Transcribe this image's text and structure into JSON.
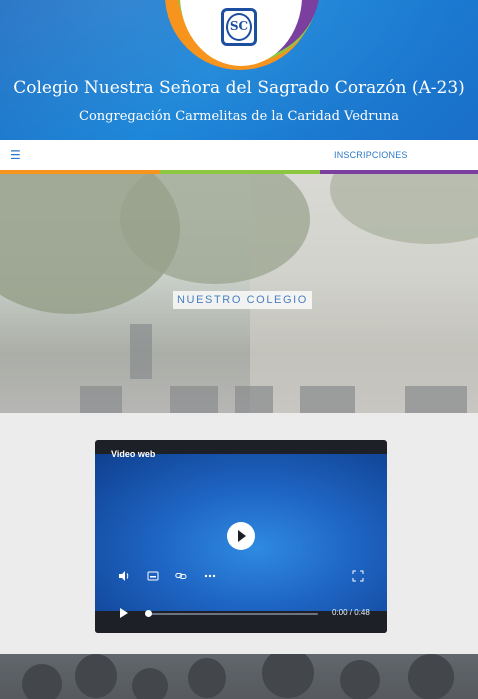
{
  "header": {
    "title": "Colegio Nuestra Señora del Sagrado Corazón (A-23)",
    "subtitle": "Congregación Carmelitas de la Caridad Vedruna",
    "logo_text": "SC",
    "colors": {
      "blue": "#1a85d8",
      "orange": "#f7941d",
      "green": "#8dc63f",
      "purple": "#7b3fa0"
    }
  },
  "nav": {
    "menu_icon": "☰",
    "link": "INSCRIPCIONES"
  },
  "hero": {
    "label": "NUESTRO COLEGIO"
  },
  "video": {
    "title": "Video web",
    "time": "0:00 / 0:48",
    "progress": 0,
    "icons": [
      "volume-icon",
      "captions-icon",
      "link-icon",
      "more-icon",
      "fullscreen-icon",
      "play-icon"
    ]
  }
}
